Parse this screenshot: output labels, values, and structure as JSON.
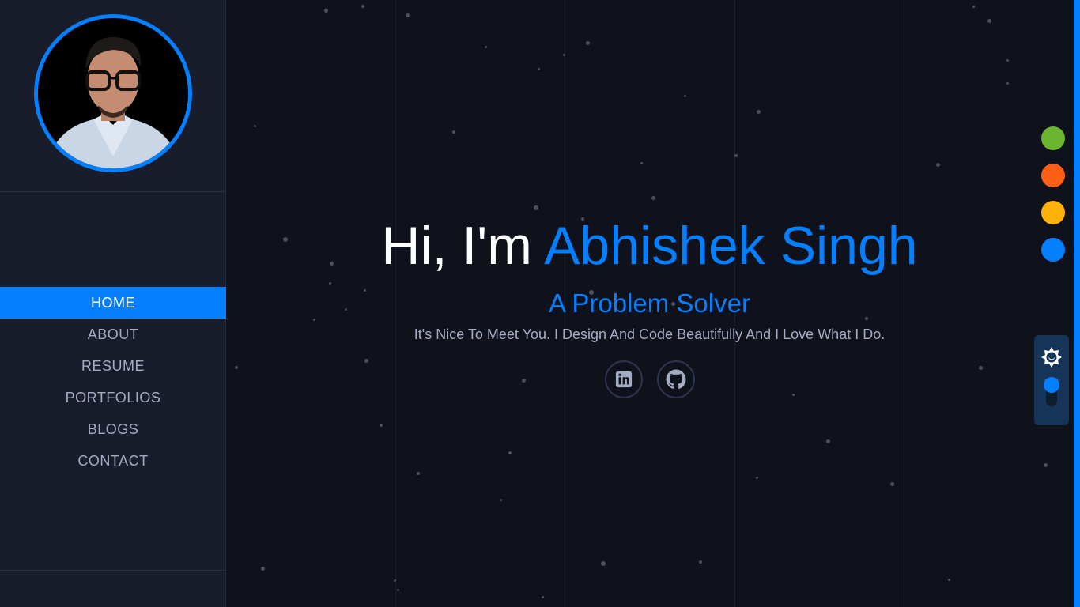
{
  "sidebar": {
    "nav": [
      {
        "label": "HOME",
        "active": true
      },
      {
        "label": "ABOUT",
        "active": false
      },
      {
        "label": "RESUME",
        "active": false
      },
      {
        "label": "PORTFOLIOS",
        "active": false
      },
      {
        "label": "BLOGS",
        "active": false
      },
      {
        "label": "CONTACT",
        "active": false
      }
    ]
  },
  "hero": {
    "greeting": "Hi, I'm",
    "name": "Abhishek Singh",
    "subtitle": "A Problem Solver",
    "tagline": "It's Nice To Meet You. I Design And Code Beautifully And I Love What I Do."
  },
  "social": [
    {
      "icon": "linkedin-icon"
    },
    {
      "icon": "github-icon"
    }
  ],
  "theme": {
    "accent": "#037fff",
    "swatches": [
      "#6ab42e",
      "#fe5f17",
      "#feb20a",
      "#037fff"
    ],
    "mode_icon": "sun-moon-icon"
  }
}
